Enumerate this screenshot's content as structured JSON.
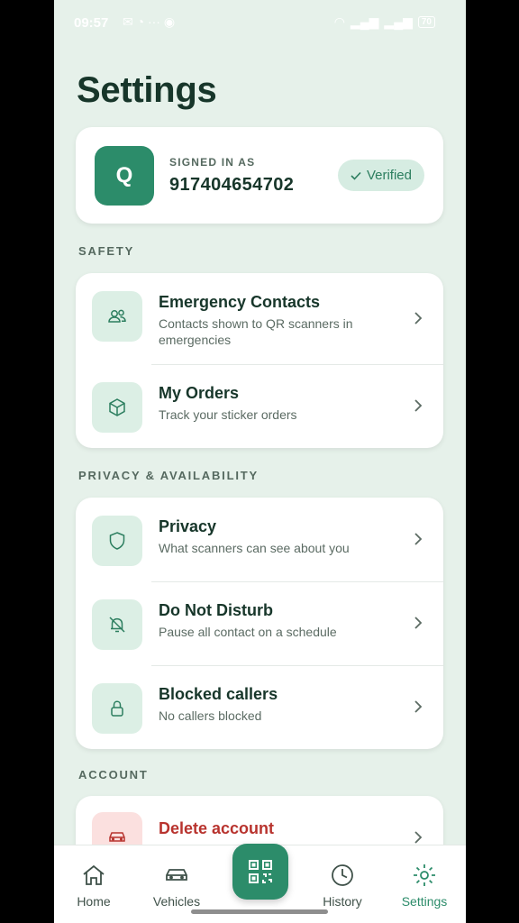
{
  "status_bar": {
    "time": "09:57",
    "battery": "70"
  },
  "page": {
    "title": "Settings"
  },
  "account": {
    "avatar_letter": "Q",
    "signed_in_label": "SIGNED IN AS",
    "phone": "917404654702",
    "verified_label": "Verified"
  },
  "sections": {
    "safety": {
      "label": "SAFETY",
      "items": [
        {
          "title": "Emergency Contacts",
          "subtitle": "Contacts shown to QR scanners in emergencies",
          "icon": "users-icon"
        },
        {
          "title": "My Orders",
          "subtitle": "Track your sticker orders",
          "icon": "box-icon"
        }
      ]
    },
    "privacy": {
      "label": "PRIVACY & AVAILABILITY",
      "items": [
        {
          "title": "Privacy",
          "subtitle": "What scanners can see about you",
          "icon": "shield-icon"
        },
        {
          "title": "Do Not Disturb",
          "subtitle": "Pause all contact on a schedule",
          "icon": "bell-off-icon"
        },
        {
          "title": "Blocked callers",
          "subtitle": "No callers blocked",
          "icon": "lock-icon"
        }
      ]
    },
    "account": {
      "label": "ACCOUNT",
      "items": [
        {
          "title": "Delete account",
          "subtitle": "",
          "icon": "car-icon"
        }
      ]
    }
  },
  "bottom_nav": {
    "items": [
      {
        "label": "Home",
        "icon": "home-icon"
      },
      {
        "label": "Vehicles",
        "icon": "car-icon"
      },
      {
        "label": "",
        "icon": "qr-code-icon"
      },
      {
        "label": "History",
        "icon": "history-icon"
      },
      {
        "label": "Settings",
        "icon": "gear-icon"
      }
    ],
    "active": "Settings"
  },
  "colors": {
    "accent": "#2c8c6a",
    "background": "#e6f1ea",
    "danger": "#b8332e"
  }
}
